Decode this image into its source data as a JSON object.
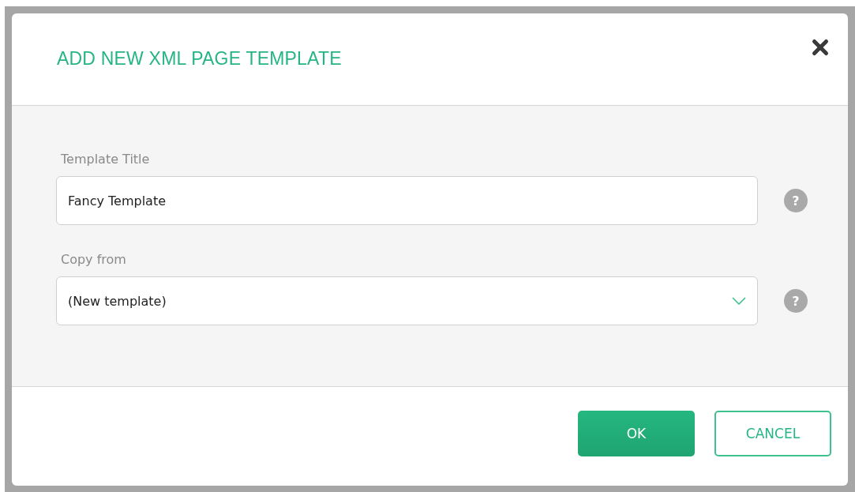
{
  "dialog": {
    "title": "ADD NEW XML PAGE TEMPLATE"
  },
  "fields": [
    {
      "kind": "text",
      "label": "Template Title",
      "value": "Fancy Template",
      "help": "?"
    },
    {
      "kind": "select",
      "label": "Copy from",
      "value": "(New template)",
      "help": "?"
    }
  ],
  "buttons": [
    {
      "kind": "primary",
      "label": "OK"
    },
    {
      "kind": "secondary",
      "label": "CANCEL"
    }
  ]
}
